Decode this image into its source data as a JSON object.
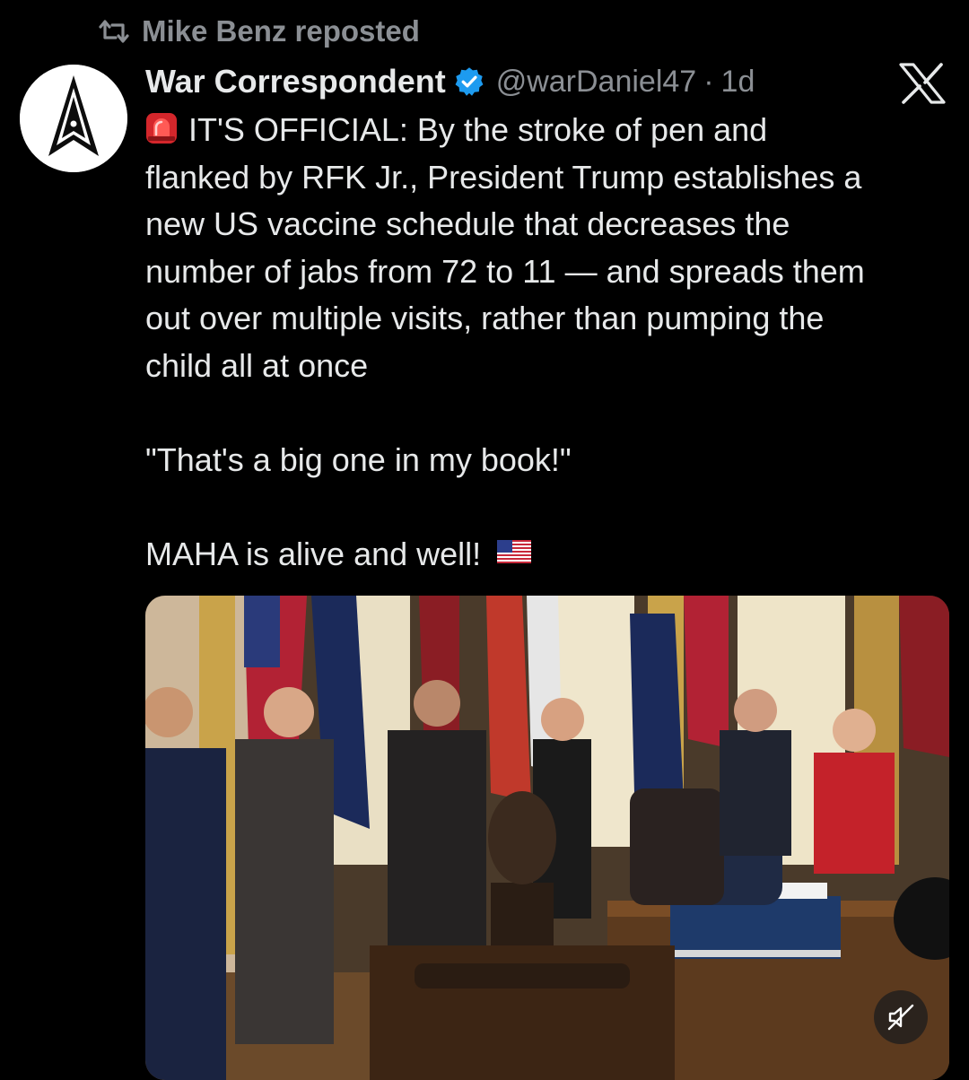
{
  "repost": {
    "label": "Mike Benz reposted",
    "icon": "repost-icon"
  },
  "author": {
    "name": "War Correspondent",
    "verified": true,
    "handle": "@warDaniel47",
    "separator": "·",
    "age": "1d",
    "avatar_icon": "space-force-delta-logo"
  },
  "platform_icon": "x-logo",
  "tweet": {
    "lines": [
      "IT'S OFFICIAL: By the stroke of pen and",
      "flanked by RFK Jr., President Trump establishes a",
      "new US vaccine schedule that decreases the",
      "number of jabs from 72 to 11 — and spreads them",
      "out over multiple visits, rather than pumping the",
      "child all at once"
    ],
    "quote": "\"That's a big one in my book!\"",
    "closing": "MAHA is alive and well!",
    "lead_emoji": "police-siren-emoji",
    "trail_emoji": "us-flag-emoji"
  },
  "media": {
    "type": "video",
    "mute_icon": "muted-speaker-icon"
  },
  "colors": {
    "background": "#000000",
    "text": "#e7e9ea",
    "secondary": "#8b8f94",
    "verified": "#1d9bf0"
  }
}
